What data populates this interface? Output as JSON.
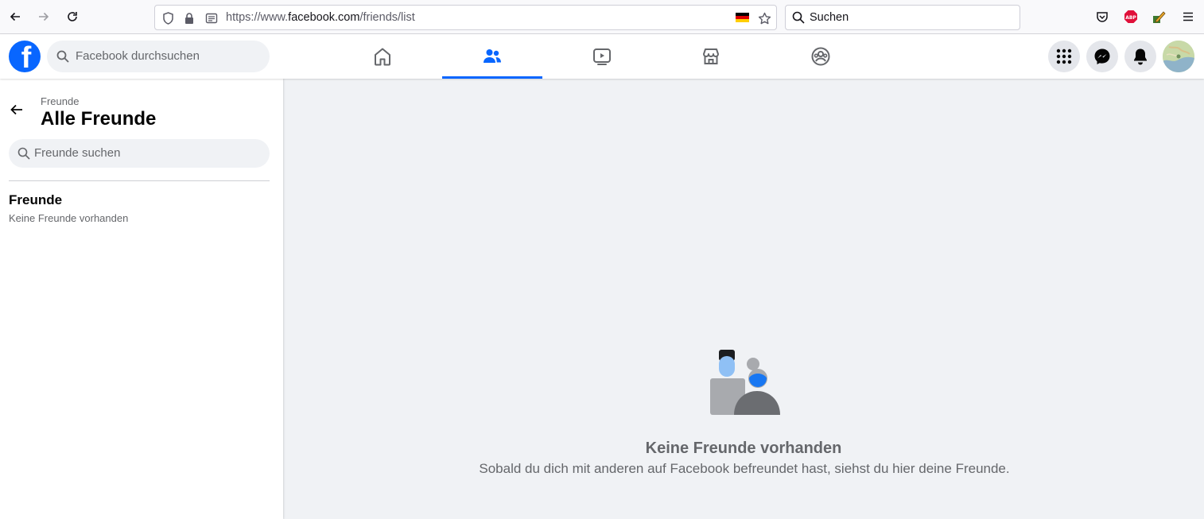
{
  "browser": {
    "url_prefix": "https://www.",
    "url_domain": "facebook.com",
    "url_path": "/friends/list",
    "search_placeholder": "Suchen"
  },
  "header": {
    "search_placeholder": "Facebook durchsuchen",
    "logo_letter": "f",
    "tabs": [
      {
        "name": "home",
        "icon": "home-icon",
        "active": false
      },
      {
        "name": "friends",
        "icon": "friends-icon",
        "active": true
      },
      {
        "name": "video",
        "icon": "video-icon",
        "active": false
      },
      {
        "name": "marketplace",
        "icon": "marketplace-icon",
        "active": false
      },
      {
        "name": "groups",
        "icon": "groups-icon",
        "active": false
      }
    ],
    "accent_color": "#0866ff"
  },
  "sidebar": {
    "breadcrumb": "Freunde",
    "title": "Alle Freunde",
    "search_placeholder": "Freunde suchen",
    "section_title": "Freunde",
    "section_subtitle": "Keine Freunde vorhanden"
  },
  "main": {
    "empty_title": "Keine Freunde vorhanden",
    "empty_subtitle": "Sobald du dich mit anderen auf Facebook befreundet hast, siehst du hier deine Freunde."
  }
}
